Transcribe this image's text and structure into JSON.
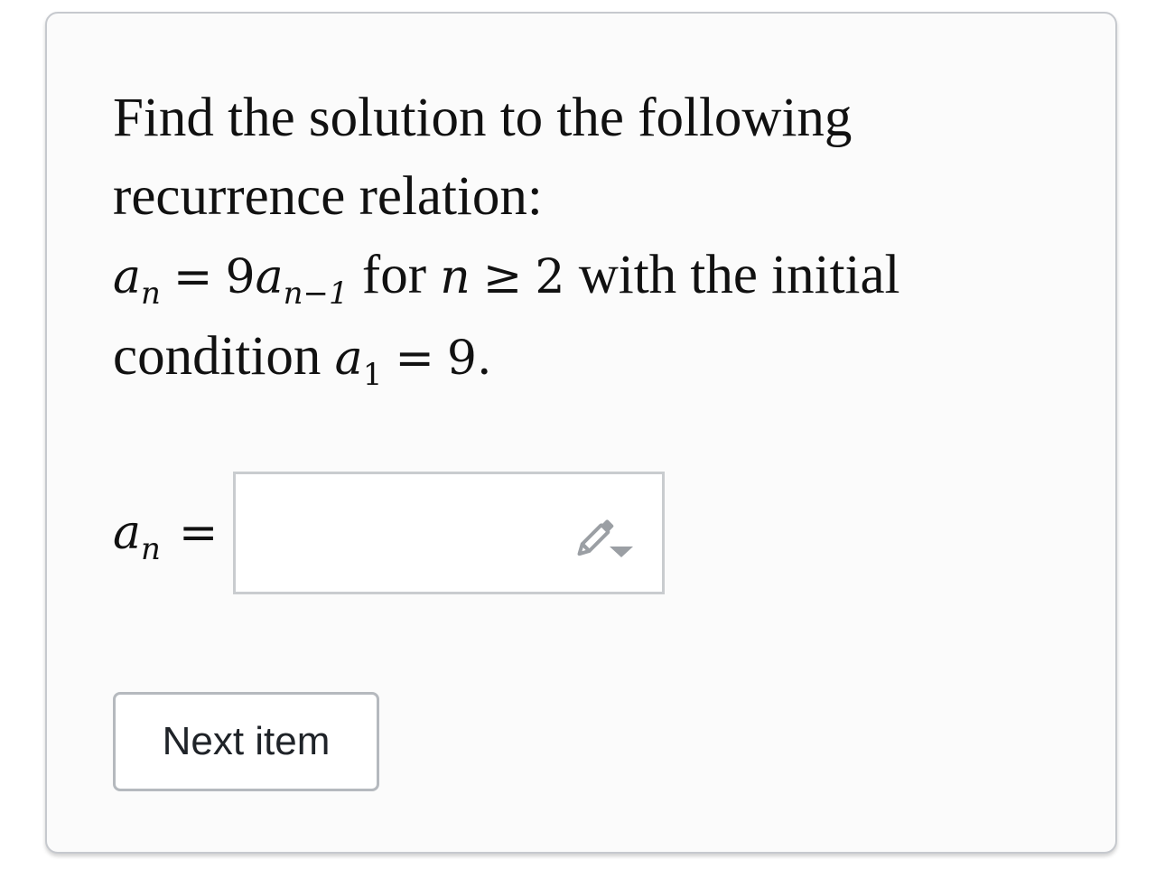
{
  "question": {
    "intro": "Find the solution to the following recurrence relation:",
    "lhs_var": "a",
    "lhs_sub": "n",
    "eq": "=",
    "coef": "9",
    "rhs_var": "a",
    "rhs_sub": "n−1",
    "for_word": "for",
    "n_var": "n",
    "geq": "≥",
    "two": "2",
    "tail": "with the initial",
    "condition_word": "condition",
    "init_var": "a",
    "init_sub": "1",
    "init_eq": "=",
    "init_val": "9."
  },
  "answer": {
    "label_var": "a",
    "label_sub": "n",
    "label_eq": "=",
    "value": "",
    "icon": "pencil-dropdown-icon"
  },
  "next_button": {
    "label": "Next item"
  },
  "colors": {
    "card_bg": "#fbfbfb",
    "card_border": "#c6c9ce",
    "input_border": "#c9cccf",
    "icon_gray": "#9b9fa4",
    "text": "#111111"
  }
}
